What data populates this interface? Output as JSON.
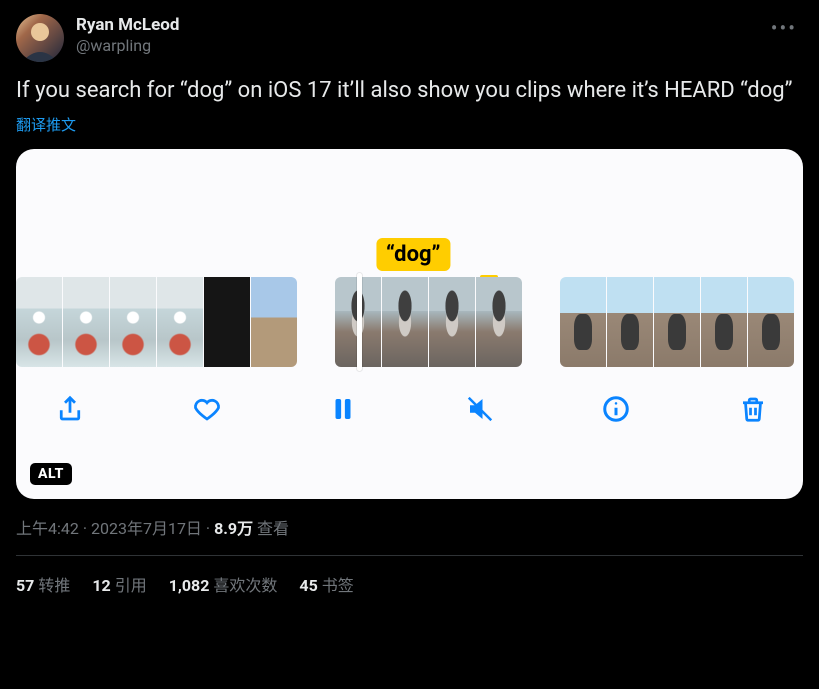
{
  "author": {
    "display_name": "Ryan McLeod",
    "handle": "@warpling"
  },
  "body_text": "If you search for “dog” on iOS 17 it’ll also show you clips where it’s HEARD “dog”",
  "translate_label": "翻译推文",
  "media": {
    "caption_bubble": "“dog”",
    "alt_badge": "ALT",
    "toolbar": {
      "share": "share",
      "like": "like",
      "pause": "pause",
      "mute": "mute",
      "info": "info",
      "delete": "delete"
    }
  },
  "meta": {
    "time": "上午4:42",
    "sep1": " · ",
    "date": "2023年7月17日",
    "sep2": " · ",
    "views_num": "8.9万",
    "views_label": " 查看"
  },
  "stats": {
    "retweets_num": "57",
    "retweets_label": "转推",
    "quotes_num": "12",
    "quotes_label": "引用",
    "likes_num": "1,082",
    "likes_label": "喜欢次数",
    "bookmarks_num": "45",
    "bookmarks_label": "书签"
  }
}
